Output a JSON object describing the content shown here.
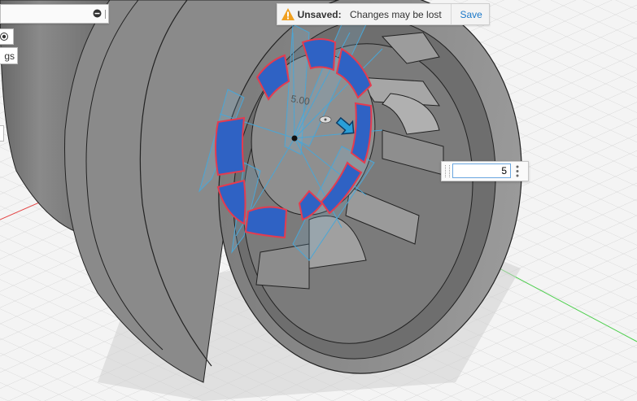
{
  "notification": {
    "icon": "warning-triangle-icon",
    "title": "Unsaved:",
    "message": "Changes may be lost",
    "save_label": "Save"
  },
  "left_panel": {
    "settings_partial": "gs"
  },
  "viewport": {
    "dimension_label": "5.00",
    "dimension_input_value": "5"
  },
  "colors": {
    "accent": "#1b78c8",
    "selection_fill": "#2f62c4",
    "selection_outline": "#e53b4f",
    "sketch_blue": "#4aa6d6",
    "warning": "#f0a020"
  }
}
